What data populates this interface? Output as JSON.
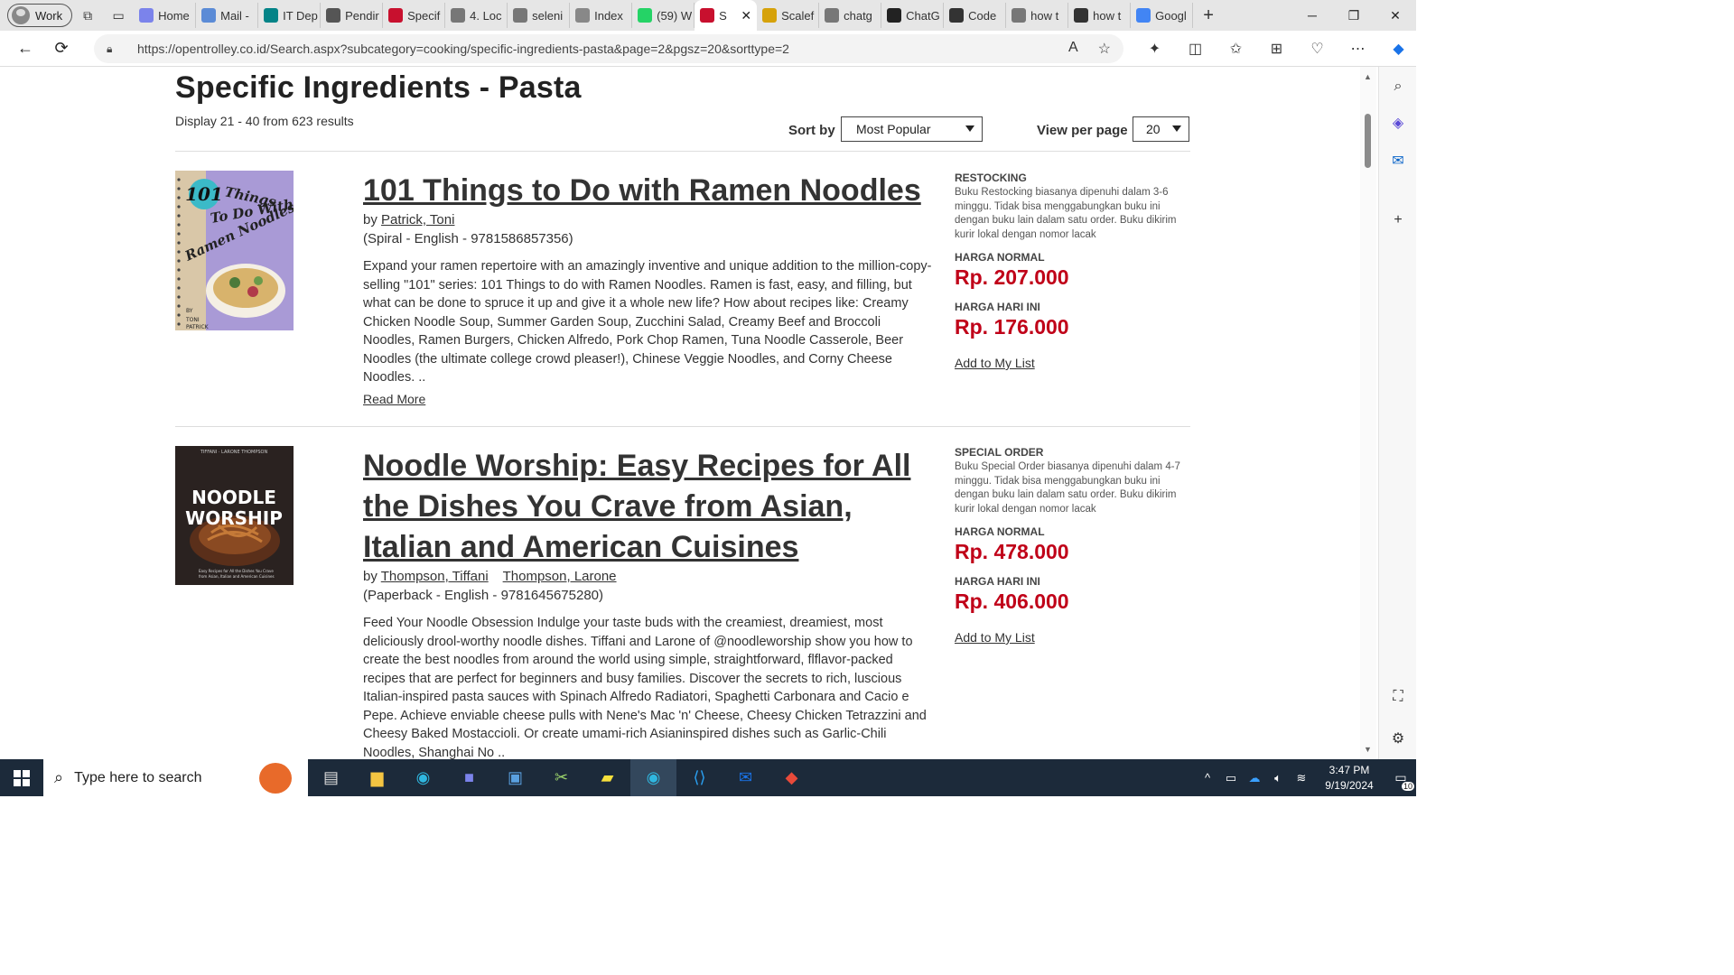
{
  "browser": {
    "profile_label": "Work",
    "tabs": [
      {
        "label": "Home",
        "color": "#7b83eb"
      },
      {
        "label": "Mail -",
        "color": "#5b8bd6"
      },
      {
        "label": "IT Dep",
        "color": "#038387"
      },
      {
        "label": "Pendir",
        "color": "#555555"
      },
      {
        "label": "Specif",
        "color": "#c8102e"
      },
      {
        "label": "4. Loc",
        "color": "#777777"
      },
      {
        "label": "seleni",
        "color": "#777777"
      },
      {
        "label": "Index",
        "color": "#888888"
      },
      {
        "label": "(59) W",
        "color": "#25d366"
      },
      {
        "label": "S",
        "color": "#c8102e",
        "active": true
      },
      {
        "label": "Scalef",
        "color": "#d6a20a"
      },
      {
        "label": "chatg",
        "color": "#777777"
      },
      {
        "label": "ChatG",
        "color": "#222222"
      },
      {
        "label": "Code",
        "color": "#333333"
      },
      {
        "label": "how t",
        "color": "#777777"
      },
      {
        "label": "how t",
        "color": "#333333"
      },
      {
        "label": "Googl",
        "color": "#4285f4"
      }
    ],
    "url": "https://opentrolley.co.id/Search.aspx?subcategory=cooking/specific-ingredients-pasta&page=2&pgsz=20&sorttype=2"
  },
  "page": {
    "heading": "Specific Ingredients - Pasta",
    "display_text": "Display 21 - 40 from 623 results",
    "sort_label": "Sort by",
    "sort_value": "Most Popular",
    "view_label": "View per page",
    "view_value": "20"
  },
  "products": [
    {
      "title": "101 Things to Do with Ramen Noodles",
      "by_label": "by",
      "authors": [
        "Patrick, Toni"
      ],
      "format": "(Spiral - English - 9781586857356)",
      "description": "Expand your ramen repertoire with an amazingly inventive and unique addition to the million-copy-selling \"101\" series: 101 Things to do with Ramen Noodles. Ramen is fast, easy, and filling, but what can be done to spruce it up and give it a whole new life? How about recipes like: Creamy Chicken Noodle Soup, Summer Garden Soup, Zucchini Salad, Creamy Beef and Broccoli Noodles, Ramen Burgers, Chicken Alfredo, Pork Chop Ramen, Tuna Noodle Casserole, Beer Noodles (the ultimate college crowd pleaser!), Chinese Veggie Noodles, and Corny Cheese Noodles. ..",
      "read_more": "Read More",
      "status": "RESTOCKING",
      "status_desc": "Buku Restocking biasanya dipenuhi dalam 3-6 minggu. Tidak bisa menggabungkan buku ini dengan buku lain dalam satu order. Buku dikirim kurir lokal dengan nomor lacak",
      "normal_label": "HARGA NORMAL",
      "normal_price": "Rp. 207.000",
      "today_label": "HARGA HARI INI",
      "today_price": "Rp. 176.000",
      "add_label": "Add to My List",
      "cover_text": "101 Things To Do With Ramen Noodles",
      "cover_author": "BY TONI PATRICK"
    },
    {
      "title": "Noodle Worship: Easy Recipes for All the Dishes You Crave from Asian, Italian and American Cuisines",
      "by_label": "by",
      "authors": [
        "Thompson, Tiffani",
        "Thompson, Larone"
      ],
      "format": "(Paperback - English - 9781645675280)",
      "description": "Feed Your Noodle Obsession Indulge your taste buds with the creamiest, dreamiest, most deliciously drool-worthy noodle dishes. Tiffani and Larone of @noodleworship show you how to create the best noodles from around the world using simple, straightforward, flflavor-packed recipes that are perfect for beginners and busy families. Discover the secrets to rich, luscious Italian-inspired pasta sauces with Spinach Alfredo Radiatori, Spaghetti Carbonara and Cacio e Pepe. Achieve enviable cheese pulls with Nene's Mac 'n' Cheese, Cheesy Chicken Tetrazzini and Cheesy Baked Mostaccioli. Or create umami-rich Asianinspired dishes such as Garlic-Chili Noodles, Shanghai No ..",
      "status": "SPECIAL ORDER",
      "status_desc": "Buku Special Order biasanya dipenuhi dalam 4-7 minggu. Tidak bisa menggabungkan buku ini dengan buku lain dalam satu order. Buku dikirim kurir lokal dengan nomor lacak",
      "normal_label": "HARGA NORMAL",
      "normal_price": "Rp. 478.000",
      "today_label": "HARGA HARI INI",
      "today_price": "Rp. 406.000",
      "add_label": "Add to My List",
      "cover_text": "NOODLE WORSHIP",
      "cover_author": "TIFFANI · LARONE THOMPSON",
      "cover_sub": "Easy Recipes for All the Dishes You Crave from Asian, Italian and American Cuisines"
    }
  ],
  "taskbar": {
    "search_placeholder": "Type here to search",
    "time": "3:47 PM",
    "date": "9/19/2024",
    "notif_count": "10"
  }
}
